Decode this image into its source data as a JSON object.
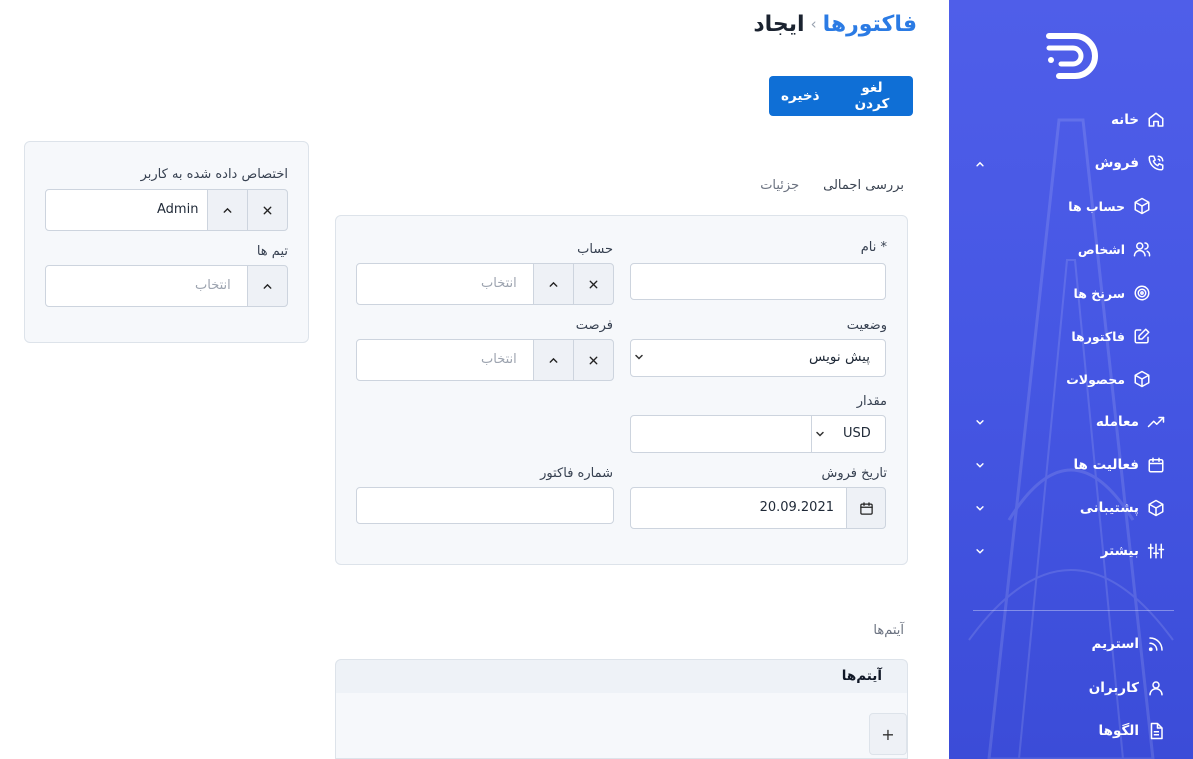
{
  "breadcrumb": {
    "parent": "فاکتورها",
    "separator": "›",
    "current": "ایجاد"
  },
  "actions": {
    "cancel_label": "لغو کردن",
    "save_label": "ذخیره"
  },
  "tabs": [
    {
      "label": "بررسی اجمالی"
    },
    {
      "label": "جزئیات"
    }
  ],
  "form": {
    "name": {
      "label": "نام *",
      "value": ""
    },
    "account": {
      "label": "حساب",
      "placeholder": "انتخاب"
    },
    "status": {
      "label": "وضعیت",
      "value": "پیش نویس"
    },
    "opportunity": {
      "label": "فرصت",
      "placeholder": "انتخاب"
    },
    "amount": {
      "label": "مقدار",
      "currency": "USD",
      "value": ""
    },
    "date_invoiced": {
      "label": "تاریخ فروش",
      "value": "20.09.2021"
    },
    "number": {
      "label": "شماره فاکتور",
      "value": ""
    }
  },
  "side_panel": {
    "assigned_user": {
      "label": "اختصاص داده شده به کاربر",
      "value": "Admin"
    },
    "teams": {
      "label": "تیم ها",
      "placeholder": "انتخاب"
    }
  },
  "items_section": {
    "label": "آیتم‌ها",
    "header": "آیتم‌ها",
    "add_label": "+"
  },
  "sidebar": {
    "items": [
      {
        "label": "خانه",
        "icon": "home-icon"
      },
      {
        "label": "فروش",
        "icon": "phone-icon"
      },
      {
        "label": "حساب ها",
        "icon": "cube-icon"
      },
      {
        "label": "اشخاص",
        "icon": "users-icon"
      },
      {
        "label": "سرنخ ها",
        "icon": "target-icon"
      },
      {
        "label": "فاکتورها",
        "icon": "edit-icon"
      },
      {
        "label": "محصولات",
        "icon": "cube-icon"
      },
      {
        "label": "معامله",
        "icon": "trending-up-icon"
      },
      {
        "label": "فعالیت ها",
        "icon": "calendar-icon"
      },
      {
        "label": "پشتیبانی",
        "icon": "cube-icon"
      },
      {
        "label": "بیشتر",
        "icon": "sliders-icon"
      },
      {
        "label": "استریم",
        "icon": "rss-icon"
      },
      {
        "label": "کاربران",
        "icon": "user-icon"
      },
      {
        "label": "الگوها",
        "icon": "document-icon"
      }
    ]
  },
  "colors": {
    "accent": "#0f6fd6",
    "sidebar": "#4657e4",
    "link": "#2b7be4"
  }
}
